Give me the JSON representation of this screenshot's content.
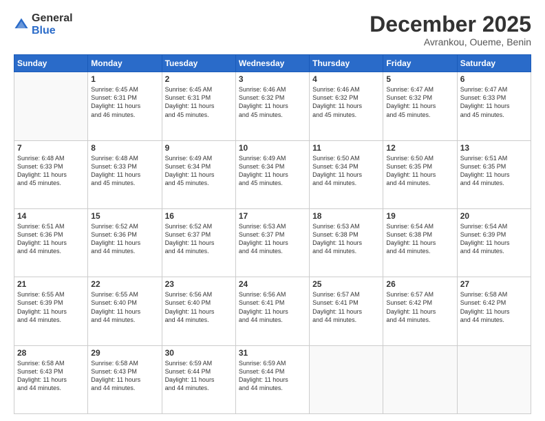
{
  "logo": {
    "general": "General",
    "blue": "Blue"
  },
  "header": {
    "month": "December 2025",
    "location": "Avrankou, Oueme, Benin"
  },
  "days": [
    "Sunday",
    "Monday",
    "Tuesday",
    "Wednesday",
    "Thursday",
    "Friday",
    "Saturday"
  ],
  "weeks": [
    [
      {
        "day": "",
        "info": ""
      },
      {
        "day": "1",
        "info": "Sunrise: 6:45 AM\nSunset: 6:31 PM\nDaylight: 11 hours\nand 46 minutes."
      },
      {
        "day": "2",
        "info": "Sunrise: 6:45 AM\nSunset: 6:31 PM\nDaylight: 11 hours\nand 45 minutes."
      },
      {
        "day": "3",
        "info": "Sunrise: 6:46 AM\nSunset: 6:32 PM\nDaylight: 11 hours\nand 45 minutes."
      },
      {
        "day": "4",
        "info": "Sunrise: 6:46 AM\nSunset: 6:32 PM\nDaylight: 11 hours\nand 45 minutes."
      },
      {
        "day": "5",
        "info": "Sunrise: 6:47 AM\nSunset: 6:32 PM\nDaylight: 11 hours\nand 45 minutes."
      },
      {
        "day": "6",
        "info": "Sunrise: 6:47 AM\nSunset: 6:33 PM\nDaylight: 11 hours\nand 45 minutes."
      }
    ],
    [
      {
        "day": "7",
        "info": "Sunrise: 6:48 AM\nSunset: 6:33 PM\nDaylight: 11 hours\nand 45 minutes."
      },
      {
        "day": "8",
        "info": "Sunrise: 6:48 AM\nSunset: 6:33 PM\nDaylight: 11 hours\nand 45 minutes."
      },
      {
        "day": "9",
        "info": "Sunrise: 6:49 AM\nSunset: 6:34 PM\nDaylight: 11 hours\nand 45 minutes."
      },
      {
        "day": "10",
        "info": "Sunrise: 6:49 AM\nSunset: 6:34 PM\nDaylight: 11 hours\nand 45 minutes."
      },
      {
        "day": "11",
        "info": "Sunrise: 6:50 AM\nSunset: 6:34 PM\nDaylight: 11 hours\nand 44 minutes."
      },
      {
        "day": "12",
        "info": "Sunrise: 6:50 AM\nSunset: 6:35 PM\nDaylight: 11 hours\nand 44 minutes."
      },
      {
        "day": "13",
        "info": "Sunrise: 6:51 AM\nSunset: 6:35 PM\nDaylight: 11 hours\nand 44 minutes."
      }
    ],
    [
      {
        "day": "14",
        "info": "Sunrise: 6:51 AM\nSunset: 6:36 PM\nDaylight: 11 hours\nand 44 minutes."
      },
      {
        "day": "15",
        "info": "Sunrise: 6:52 AM\nSunset: 6:36 PM\nDaylight: 11 hours\nand 44 minutes."
      },
      {
        "day": "16",
        "info": "Sunrise: 6:52 AM\nSunset: 6:37 PM\nDaylight: 11 hours\nand 44 minutes."
      },
      {
        "day": "17",
        "info": "Sunrise: 6:53 AM\nSunset: 6:37 PM\nDaylight: 11 hours\nand 44 minutes."
      },
      {
        "day": "18",
        "info": "Sunrise: 6:53 AM\nSunset: 6:38 PM\nDaylight: 11 hours\nand 44 minutes."
      },
      {
        "day": "19",
        "info": "Sunrise: 6:54 AM\nSunset: 6:38 PM\nDaylight: 11 hours\nand 44 minutes."
      },
      {
        "day": "20",
        "info": "Sunrise: 6:54 AM\nSunset: 6:39 PM\nDaylight: 11 hours\nand 44 minutes."
      }
    ],
    [
      {
        "day": "21",
        "info": "Sunrise: 6:55 AM\nSunset: 6:39 PM\nDaylight: 11 hours\nand 44 minutes."
      },
      {
        "day": "22",
        "info": "Sunrise: 6:55 AM\nSunset: 6:40 PM\nDaylight: 11 hours\nand 44 minutes."
      },
      {
        "day": "23",
        "info": "Sunrise: 6:56 AM\nSunset: 6:40 PM\nDaylight: 11 hours\nand 44 minutes."
      },
      {
        "day": "24",
        "info": "Sunrise: 6:56 AM\nSunset: 6:41 PM\nDaylight: 11 hours\nand 44 minutes."
      },
      {
        "day": "25",
        "info": "Sunrise: 6:57 AM\nSunset: 6:41 PM\nDaylight: 11 hours\nand 44 minutes."
      },
      {
        "day": "26",
        "info": "Sunrise: 6:57 AM\nSunset: 6:42 PM\nDaylight: 11 hours\nand 44 minutes."
      },
      {
        "day": "27",
        "info": "Sunrise: 6:58 AM\nSunset: 6:42 PM\nDaylight: 11 hours\nand 44 minutes."
      }
    ],
    [
      {
        "day": "28",
        "info": "Sunrise: 6:58 AM\nSunset: 6:43 PM\nDaylight: 11 hours\nand 44 minutes."
      },
      {
        "day": "29",
        "info": "Sunrise: 6:58 AM\nSunset: 6:43 PM\nDaylight: 11 hours\nand 44 minutes."
      },
      {
        "day": "30",
        "info": "Sunrise: 6:59 AM\nSunset: 6:44 PM\nDaylight: 11 hours\nand 44 minutes."
      },
      {
        "day": "31",
        "info": "Sunrise: 6:59 AM\nSunset: 6:44 PM\nDaylight: 11 hours\nand 44 minutes."
      },
      {
        "day": "",
        "info": ""
      },
      {
        "day": "",
        "info": ""
      },
      {
        "day": "",
        "info": ""
      }
    ]
  ]
}
